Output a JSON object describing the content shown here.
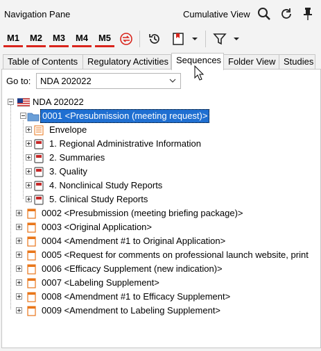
{
  "header": {
    "title": "Navigation Pane",
    "view_label": "Cumulative View",
    "icons": [
      "search-icon",
      "refresh-icon",
      "pin-icon"
    ]
  },
  "toolbar": {
    "milestones": [
      "M1",
      "M2",
      "M3",
      "M4",
      "M5"
    ],
    "icons": [
      "sync-icon",
      "history-icon",
      "bookmark-icon",
      "dropdown-icon",
      "filter-icon",
      "dropdown-icon"
    ]
  },
  "tabs": [
    {
      "label": "Table of Contents"
    },
    {
      "label": "Regulatory Activities"
    },
    {
      "label": "Sequences",
      "active": true
    },
    {
      "label": "Folder View"
    },
    {
      "label": "Studies"
    }
  ],
  "goto": {
    "label": "Go to:",
    "value": "NDA 202022"
  },
  "tree": {
    "root": "NDA 202022",
    "selected": "0001 <Presubmission (meeting request)>",
    "children": [
      "Envelope",
      "1. Regional Administrative Information",
      "2. Summaries",
      "3. Quality",
      "4. Nonclinical Study Reports",
      "5. Clinical Study Reports"
    ],
    "sequences": [
      "0002 <Presubmission (meeting briefing package)>",
      "0003 <Original Application>",
      "0004 <Amendment #1 to Original Application>",
      "0005 <Request for comments on professional launch website, print",
      "0006 <Efficacy Supplement (new indication)>",
      "0007 <Labeling Supplement>",
      "0008 <Amendment #1 to Efficacy Supplement>",
      "0009 <Amendment to Labeling Supplement>"
    ]
  },
  "colors": {
    "accent": "#1f6fd1",
    "milestone_underline": "#d9241c",
    "doc_icon": "#e8761a"
  }
}
